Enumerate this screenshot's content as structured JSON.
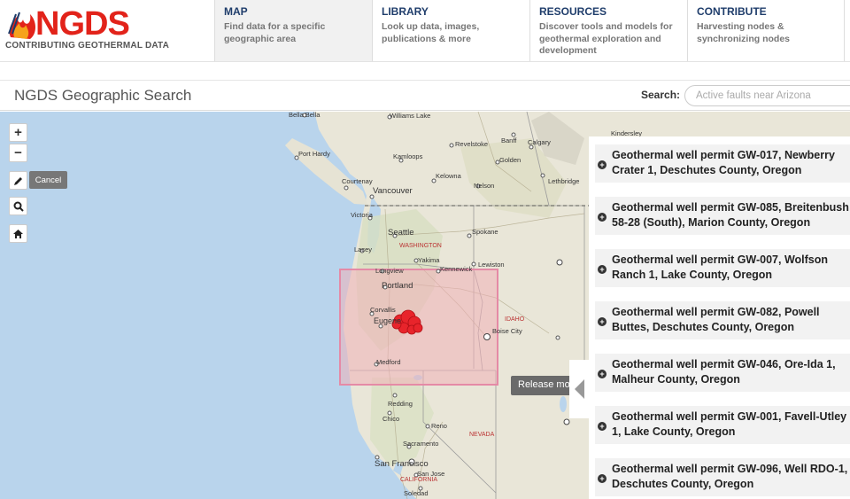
{
  "brand": {
    "logo_text": "NGDS",
    "tagline": "CONTRIBUTING GEOTHERMAL DATA"
  },
  "nav": [
    {
      "title": "MAP",
      "desc": "Find data for a specific geographic area"
    },
    {
      "title": "LIBRARY",
      "desc": "Look up data, images, publications & more"
    },
    {
      "title": "RESOURCES",
      "desc": "Discover tools and models for geothermal exploration and development"
    },
    {
      "title": "CONTRIBUTE",
      "desc": "Harvesting nodes & synchronizing nodes"
    }
  ],
  "page": {
    "title": "NGDS Geographic Search",
    "search_label": "Search:",
    "search_placeholder": "Active faults near Arizona"
  },
  "map_controls": {
    "zoom_in": "+",
    "zoom_out": "−",
    "cancel_label": "Cancel",
    "release_tip": "Release mo"
  },
  "map_labels": {
    "cities": [
      "Bella Bella",
      "Williams Lake",
      "Banff",
      "Port Hardy",
      "Revelstoke",
      "Calgary",
      "Kamloops",
      "Golden",
      "Kelowna",
      "Courtenay",
      "Vancouver",
      "Nelson",
      "Lethbridge",
      "Victoria",
      "Seattle",
      "Spokane",
      "Lacey",
      "Yakima",
      "Lewiston",
      "Longview",
      "Kennewick",
      "Portland",
      "Corvallis",
      "Eugene",
      "Boise City",
      "Medford",
      "Redding",
      "Chico",
      "Reno",
      "Sacramento",
      "San Francisco",
      "San Jose",
      "Soledad",
      "Kindersley"
    ],
    "regions": [
      "WASHINGTON",
      "IDAHO",
      "NEVADA",
      "CALIFORNIA"
    ]
  },
  "results": [
    "Geothermal well permit GW-017, Newberry Crater 1, Deschutes County, Oregon",
    "Geothermal well permit GW-085, Breitenbush 58-28 (South), Marion County, Oregon",
    "Geothermal well permit GW-007, Wolfson Ranch 1, Lake County, Oregon",
    "Geothermal well permit GW-082, Powell Buttes, Deschutes County, Oregon",
    "Geothermal well permit GW-046, Ore-Ida 1, Malheur County, Oregon",
    "Geothermal well permit GW-001, Favell-Utley 1, Lake County, Oregon",
    "Geothermal well permit GW-096, Well RDO-1, Deschutes County, Oregon"
  ],
  "colors": {
    "brand_red": "#e2231a",
    "nav_title": "#1f3d6b",
    "ocean": "#b9d4ec",
    "land": "#e9e6d8",
    "selection_fill": "#f0b0b8",
    "selection_stroke": "#e58aa6",
    "marker": "#e8242b"
  }
}
